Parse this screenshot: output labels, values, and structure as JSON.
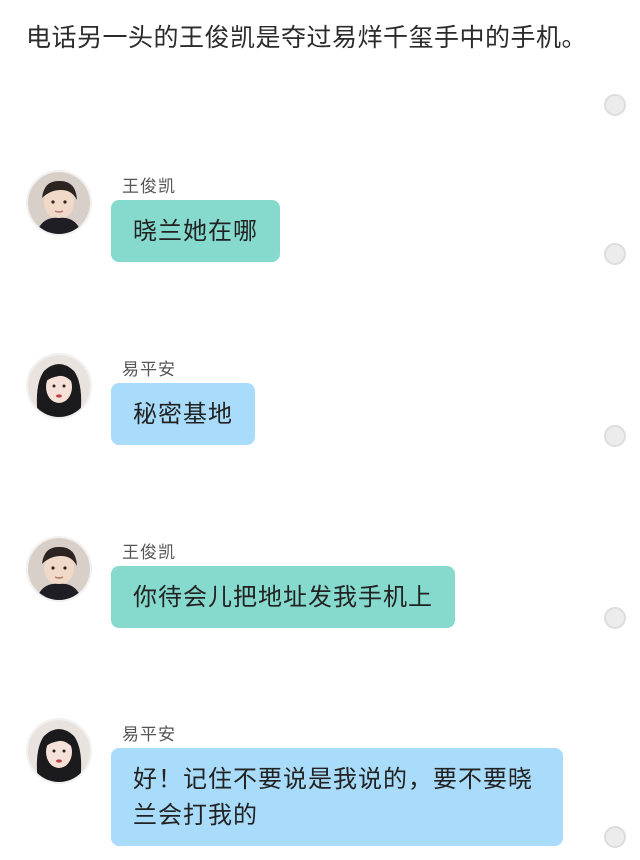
{
  "narration": "电话另一头的王俊凯是夺过易烊千玺手中的手机。",
  "accent": {
    "bubble_green": "#86d9cd",
    "bubble_blue": "#a9dcfa"
  },
  "messages": [
    {
      "sender": "王俊凯",
      "text": "晓兰她在哪",
      "bubble_color": "green",
      "avatar": "male-avatar-icon"
    },
    {
      "sender": "易平安",
      "text": "秘密基地",
      "bubble_color": "blue",
      "avatar": "female-avatar-icon"
    },
    {
      "sender": "王俊凯",
      "text": "你待会儿把地址发我手机上",
      "bubble_color": "green",
      "avatar": "male-avatar-icon"
    },
    {
      "sender": "易平安",
      "text": "好！记住不要说是我说的，要不要晓兰会打我的",
      "bubble_color": "blue",
      "avatar": "female-avatar-icon"
    }
  ]
}
